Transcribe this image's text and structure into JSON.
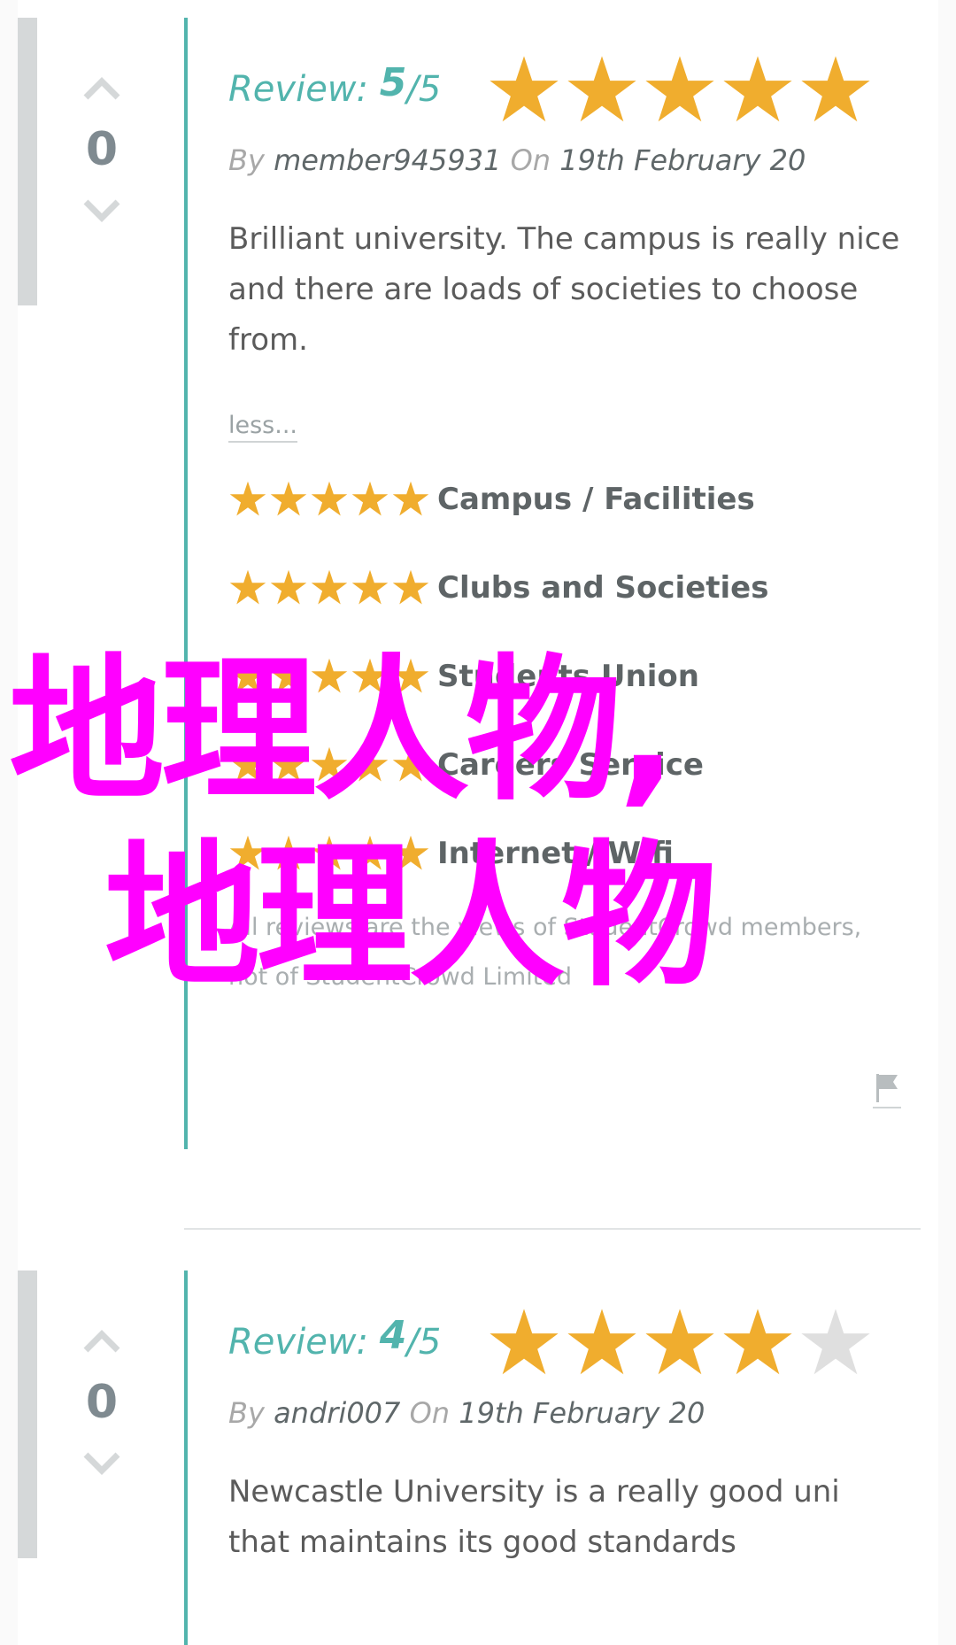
{
  "colors": {
    "accent": "#52b4ad",
    "star_filled": "#f0ad2e",
    "star_empty": "#dfdfdf",
    "watermark": "#ff00ff"
  },
  "reviews": [
    {
      "votes": "0",
      "review_label": "Review:",
      "score": "5",
      "score_max": "/5",
      "rating": 5,
      "by_label": "By",
      "author": "member945931",
      "on_label": "On",
      "date": "19th February 20",
      "text": "Brilliant university. The campus is really nice and there are loads of societies to choose from.",
      "less_link": "less...",
      "categories": [
        {
          "label": "Campus / Facilities",
          "rating": 5
        },
        {
          "label": "Clubs and Societies",
          "rating": 5
        },
        {
          "label": "Students Union",
          "rating": 5
        },
        {
          "label": "Careers Service",
          "rating": 5
        },
        {
          "label": "Internet / Wifi",
          "rating": 5
        }
      ],
      "disclaimer": "All reviews are the views of StudentCrowd members, not of StudentCrowd Limited",
      "flag_icon": "flag-icon"
    },
    {
      "votes": "0",
      "review_label": "Review:",
      "score": "4",
      "score_max": "/5",
      "rating": 4,
      "by_label": "By",
      "author": "andri007",
      "on_label": "On",
      "date": "19th February 20",
      "text": "Newcastle University is a really good uni that maintains its good standards"
    }
  ],
  "watermark": {
    "line1": "地理人物,",
    "line2": "地理人物"
  }
}
